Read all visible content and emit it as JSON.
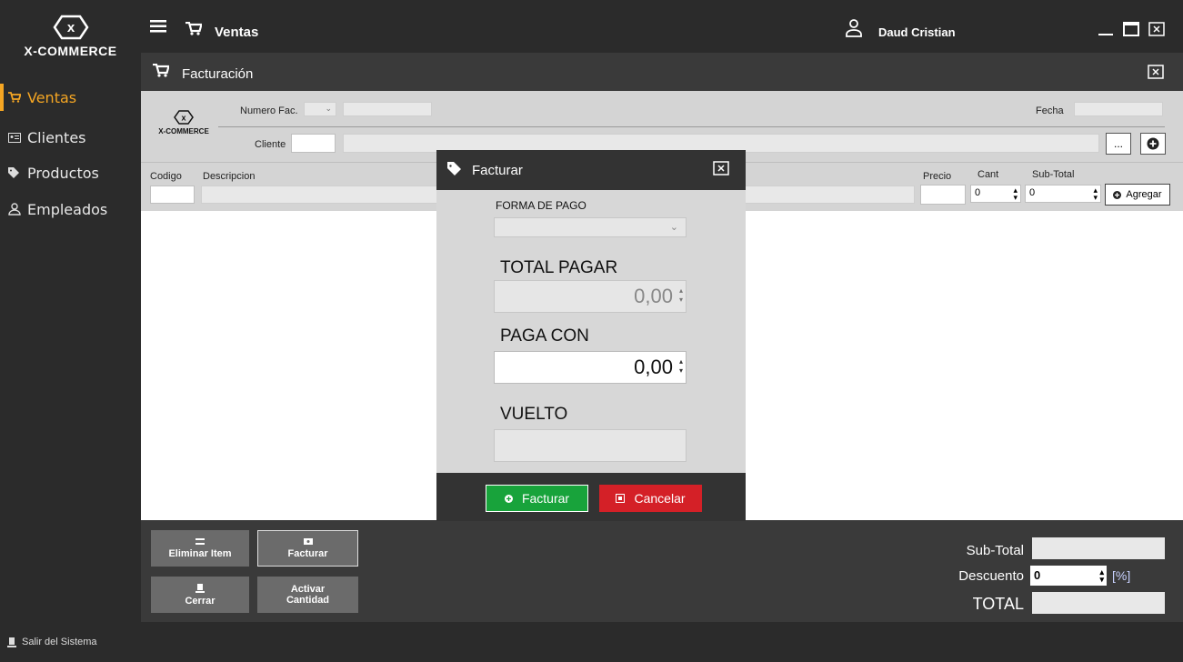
{
  "brand": {
    "name": "X-COMMERCE",
    "small_name": "X-COMMERCE"
  },
  "sidebar": {
    "items": [
      {
        "label": "Ventas",
        "icon": "cart-icon",
        "active": true
      },
      {
        "label": "Clientes",
        "icon": "id-card-icon"
      },
      {
        "label": "Productos",
        "icon": "tag-icon"
      },
      {
        "label": "Empleados",
        "icon": "user-icon"
      }
    ],
    "logout_label": "Salir del Sistema"
  },
  "topbar": {
    "module_title": "Ventas",
    "user_name": "Daud Cristian"
  },
  "window": {
    "title": "Facturación"
  },
  "form": {
    "numero_fac_label": "Numero Fac.",
    "fecha_label": "Fecha",
    "cliente_label": "Cliente",
    "cliente_search_btn": "...",
    "codigo_label": "Codigo",
    "descripcion_label": "Descripcion",
    "precio_label": "Precio",
    "cant_label": "Cant",
    "subtotal_label": "Sub-Total",
    "cant_value": "0",
    "subtotal_value": "0",
    "agregar_label": "Agregar"
  },
  "bottom": {
    "eliminar_label": "Eliminar Item",
    "facturar_label": "Facturar",
    "cerrar_label": "Cerrar",
    "activar_label_1": "Activar",
    "activar_label_2": "Cantidad",
    "subtotal_label": "Sub-Total",
    "descuento_label": "Descuento",
    "descuento_value": "0",
    "percent_label": "[%]",
    "total_label": "TOTAL"
  },
  "modal": {
    "title": "Facturar",
    "forma_pago_label": "FORMA DE PAGO",
    "total_pagar_label": "TOTAL PAGAR",
    "total_pagar_value": "0,00",
    "paga_con_label": "PAGA CON",
    "paga_con_value": "0,00",
    "vuelto_label": "VUELTO",
    "facturar_btn": "Facturar",
    "cancelar_btn": "Cancelar"
  },
  "colors": {
    "accent": "#f5a623",
    "confirm": "#18a33b",
    "cancel": "#d42027"
  }
}
